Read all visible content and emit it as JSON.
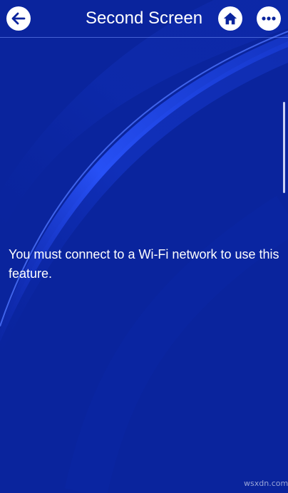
{
  "header": {
    "title": "Second Screen",
    "back_icon": "arrow-left-icon",
    "home_icon": "home-icon",
    "more_icon": "more-horizontal-icon"
  },
  "message": "You must connect to a Wi-Fi network to use this feature.",
  "watermark": "wsxdn.com",
  "colors": {
    "background": "#0a249d",
    "accent_arc": "#1f4df0",
    "text": "#ffffff"
  }
}
